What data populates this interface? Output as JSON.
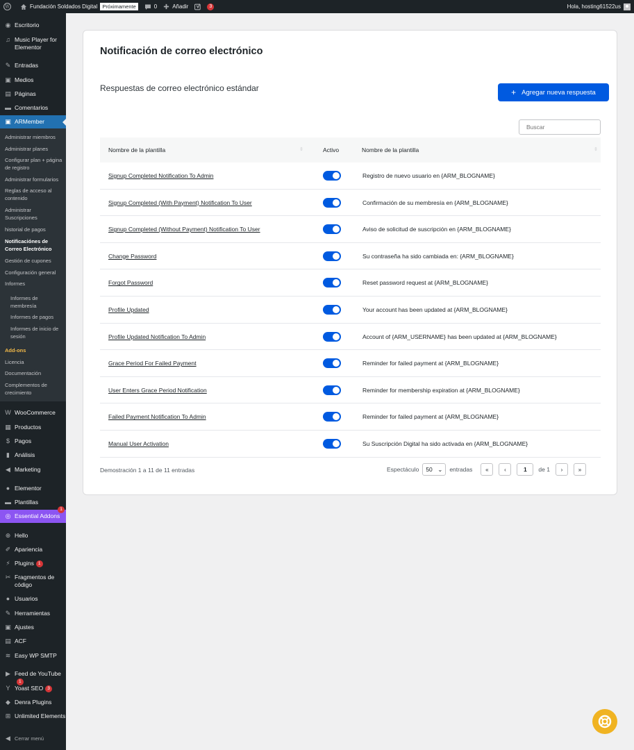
{
  "adminbar": {
    "site_name": "Fundación Soldados Digital",
    "badge": "Próximamente",
    "comments_count": "0",
    "add_label": "Añadir",
    "yoast_count": "3",
    "greeting": "Hola, hosting61522us"
  },
  "sidebar": {
    "escritorio": "Escritorio",
    "music_player": "Music Player for Elementor",
    "entradas": "Entradas",
    "medios": "Medios",
    "paginas": "Páginas",
    "comentarios": "Comentarios",
    "armember": "ARMember",
    "sub": {
      "miembros": "Administrar miembros",
      "planes": "Administrar planes",
      "configurar_plan": "Configurar plan + página de registro",
      "formularios": "Administrar formularios",
      "reglas": "Reglas de acceso al contenido",
      "suscripciones": "Administrar Suscripciones",
      "historial": "historial de pagos",
      "notificaciones": "Notificaciónes de Correo Electrónico",
      "cupones": "Gestión de cupones",
      "configuracion": "Configuración general",
      "informes": "Informes",
      "informes_membresia": "Informes de membresía",
      "informes_pagos": "Informes de pagos",
      "informes_sesion": "Informes de inicio de sesión",
      "addons": "Add-ons",
      "licencia": "Licencia",
      "documentacion": "Documentación",
      "complementos": "Complementos de crecimiento"
    },
    "woocommerce": "WooCommerce",
    "productos": "Productos",
    "pagos": "Pagos",
    "analisis": "Análisis",
    "marketing": "Marketing",
    "elementor": "Elementor",
    "plantillas": "Plantillas",
    "essential_addons": "Essential Addons",
    "essential_addons_badge": "1",
    "hello": "Hello",
    "apariencia": "Apariencia",
    "plugins": "Plugins",
    "plugins_badge": "1",
    "fragmentos": "Fragmentos de código",
    "usuarios": "Usuarios",
    "herramientas": "Herramientas",
    "ajustes": "Ajustes",
    "acf": "ACF",
    "easy_wp_smtp": "Easy WP SMTP",
    "feed_youtube": "Feed de YouTube",
    "feed_youtube_badge": "1",
    "yoast": "Yoast SEO",
    "yoast_badge": "3",
    "denra": "Denra Plugins",
    "unlimited": "Unlimited Elements",
    "cerrar": "Cerrar menú"
  },
  "main": {
    "title": "Notificación de correo electrónico",
    "section_title": "Respuestas de correo electrónico estándar",
    "add_button": "Agregar nueva respuesta",
    "search_placeholder": "Buscar",
    "columns": [
      "Nombre de la plantilla",
      "Activo",
      "Nombre de la plantilla"
    ],
    "rows": [
      {
        "name": "Signup Completed Notification To Admin",
        "active": true,
        "subject": "Registro de nuevo usuario en {ARM_BLOGNAME}"
      },
      {
        "name": "Signup Completed (With Payment) Notification To User",
        "active": true,
        "subject": "Confirmación de su membresía en {ARM_BLOGNAME}"
      },
      {
        "name": "Signup Completed (Without Payment) Notification To User",
        "active": true,
        "subject": "Aviso de solicitud de suscripción en {ARM_BLOGNAME}"
      },
      {
        "name": "Change Password",
        "active": true,
        "subject": "Su contraseña ha sido cambiada en: {ARM_BLOGNAME}"
      },
      {
        "name": "Forgot Password",
        "active": true,
        "subject": "Reset password request at {ARM_BLOGNAME}"
      },
      {
        "name": "Profile Updated",
        "active": true,
        "subject": "Your account has been updated at {ARM_BLOGNAME}"
      },
      {
        "name": "Profile Updated Notification To Admin",
        "active": true,
        "subject": "Account of {ARM_USERNAME} has been updated at {ARM_BLOGNAME}"
      },
      {
        "name": "Grace Period For Failed Payment",
        "active": true,
        "subject": "Reminder for failed payment at {ARM_BLOGNAME}"
      },
      {
        "name": "User Enters Grace Period Notification",
        "active": true,
        "subject": "Reminder for membership expiration at {ARM_BLOGNAME}"
      },
      {
        "name": "Failed Payment Notification To Admin",
        "active": true,
        "subject": "Reminder for failed payment at {ARM_BLOGNAME}"
      },
      {
        "name": "Manual User Activation",
        "active": true,
        "subject": "Su Suscripción Digital ha sido activada en {ARM_BLOGNAME}"
      }
    ],
    "footer_info": "Demostración 1 a 11 de 11 entradas",
    "show_label": "Espectáculo",
    "per_page": "50",
    "entries_label": "entradas",
    "current_page": "1",
    "of_label": "de 1"
  }
}
